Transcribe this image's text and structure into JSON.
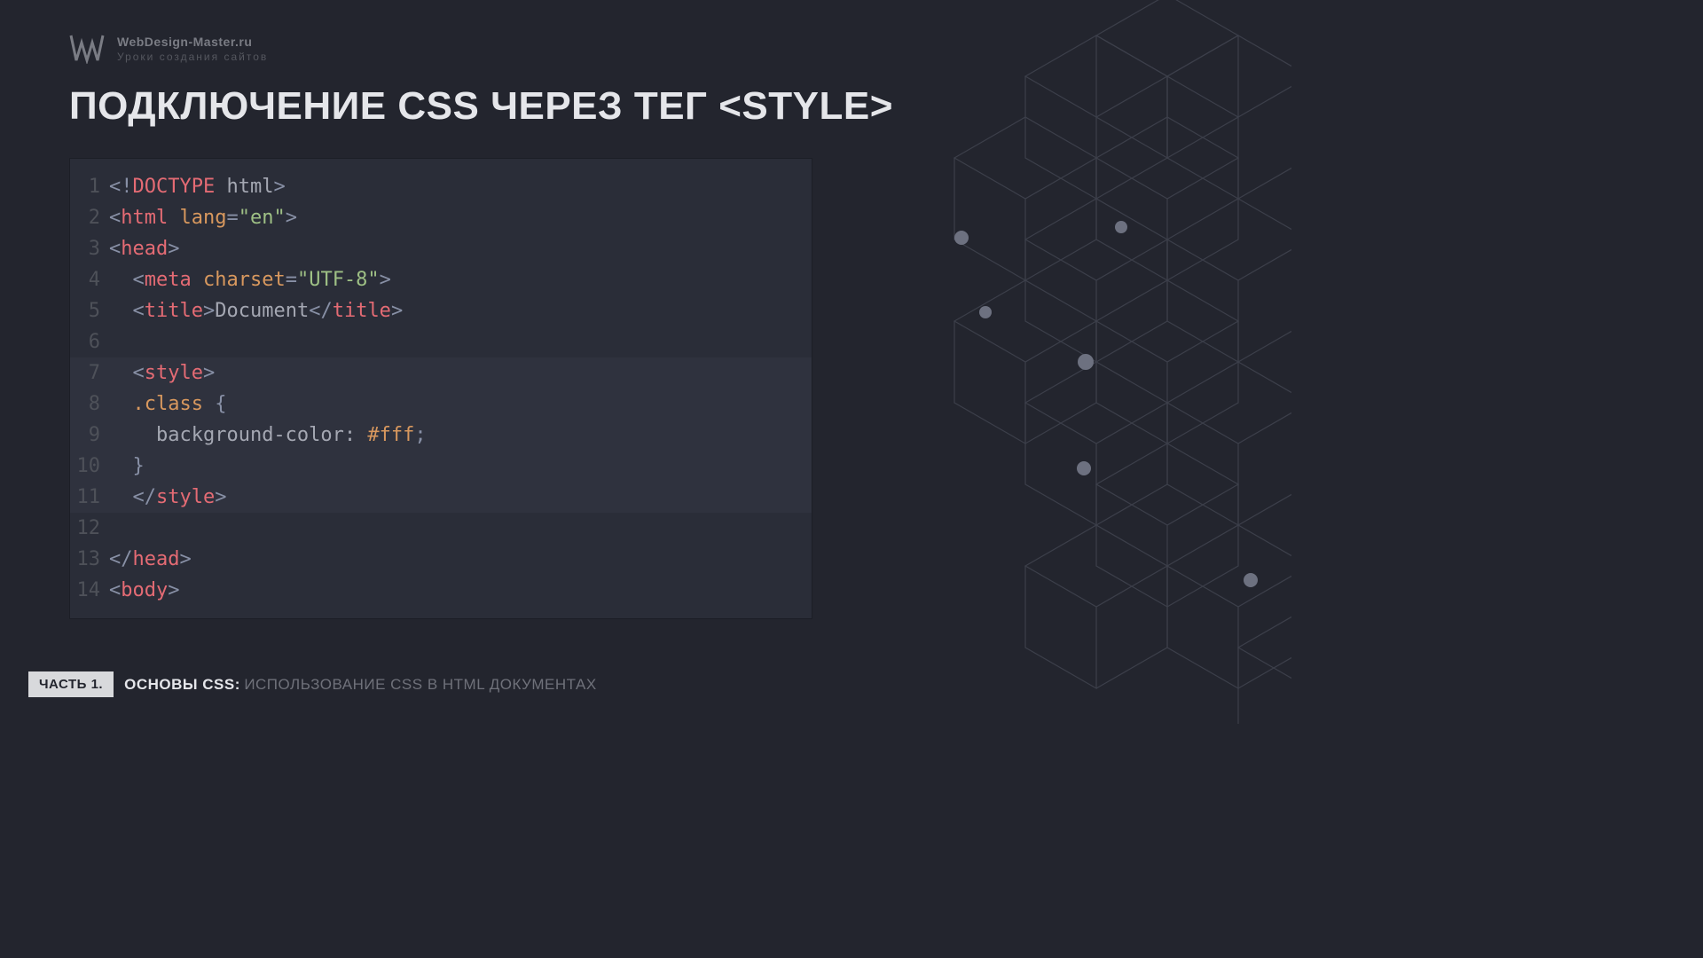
{
  "site": {
    "name": "WebDesign-Master.ru",
    "tagline": "Уроки создания сайтов"
  },
  "page_title": "ПОДКЛЮЧЕНИЕ CSS ЧЕРЕЗ ТЕГ <STYLE>",
  "code": {
    "line_numbers": [
      "1",
      "2",
      "3",
      "4",
      "5",
      "6",
      "7",
      "8",
      "9",
      "10",
      "11",
      "12",
      "13",
      "14"
    ]
  },
  "tokens": {
    "lt": "<",
    "gt": ">",
    "ltbang": "<!",
    "ltslash": "</",
    "eq": "=",
    "lbrace": "{",
    "rbrace": "}",
    "semi": ";",
    "doctype": "DOCTYPE",
    "html_kw": "html",
    "tag_html": "html",
    "tag_head": "head",
    "tag_meta": "meta",
    "tag_title": "title",
    "tag_style": "style",
    "tag_body": "body",
    "attr_lang": "lang",
    "attr_charset": "charset",
    "val_en": "\"en\"",
    "val_utf8": "\"UTF-8\"",
    "text_document": "Document",
    "css_selector": ".class",
    "css_prop_bg": "background-color:",
    "css_val_fff": "#fff"
  },
  "footer": {
    "part_badge": "ЧАСТЬ 1.",
    "strong": "ОСНОВЫ CSS:",
    "light": "ИСПОЛЬЗОВАНИЕ CSS В HTML ДОКУМЕНТАХ"
  }
}
